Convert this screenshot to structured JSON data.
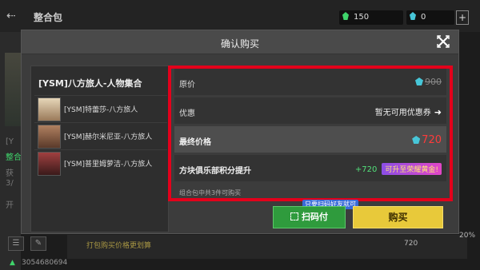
{
  "header": {
    "title": "整合包"
  },
  "currency": {
    "green": "150",
    "blue": "0"
  },
  "status": {
    "device_id": "3054680694"
  },
  "background": {
    "left_texts": [
      "[Y",
      "整合",
      "获",
      "3/",
      "开"
    ],
    "bottom_left": "打包购买价格更划算",
    "bottom_right": "720",
    "bottom_percent": "20%"
  },
  "dialog": {
    "title": "确认购买",
    "bundle": {
      "name": "[YSM]八方旅人-人物集合",
      "items": [
        {
          "label": "[YSM]特蕾莎-八方旅人"
        },
        {
          "label": "[YSM]赫尔米尼亚-八方旅人"
        },
        {
          "label": "[YSM]普里姆萝洁-八方旅人"
        }
      ]
    },
    "original_price": {
      "label": "原价",
      "value": "900"
    },
    "discount": {
      "label": "优惠",
      "value": "暂无可用优惠券"
    },
    "final_price": {
      "label": "最终价格",
      "value": "720"
    },
    "points": {
      "label": "方块俱乐部积分提升",
      "value": "+720",
      "badge": "可升至荣耀黄金!"
    },
    "hint": "组合包中共3件可购买",
    "tag": "只要扫码好友就可",
    "scan_button": "扫码付",
    "buy_button": "购买"
  },
  "colors": {
    "highlight_border": "#e3001b",
    "final_price": "#ff3b3b",
    "buy": "#e8c93a",
    "scan": "#2f9b3d"
  },
  "icons": [
    "back-icon",
    "close-icon",
    "diamond-icon",
    "arrow-right-icon",
    "scan-icon",
    "wifi-icon"
  ]
}
